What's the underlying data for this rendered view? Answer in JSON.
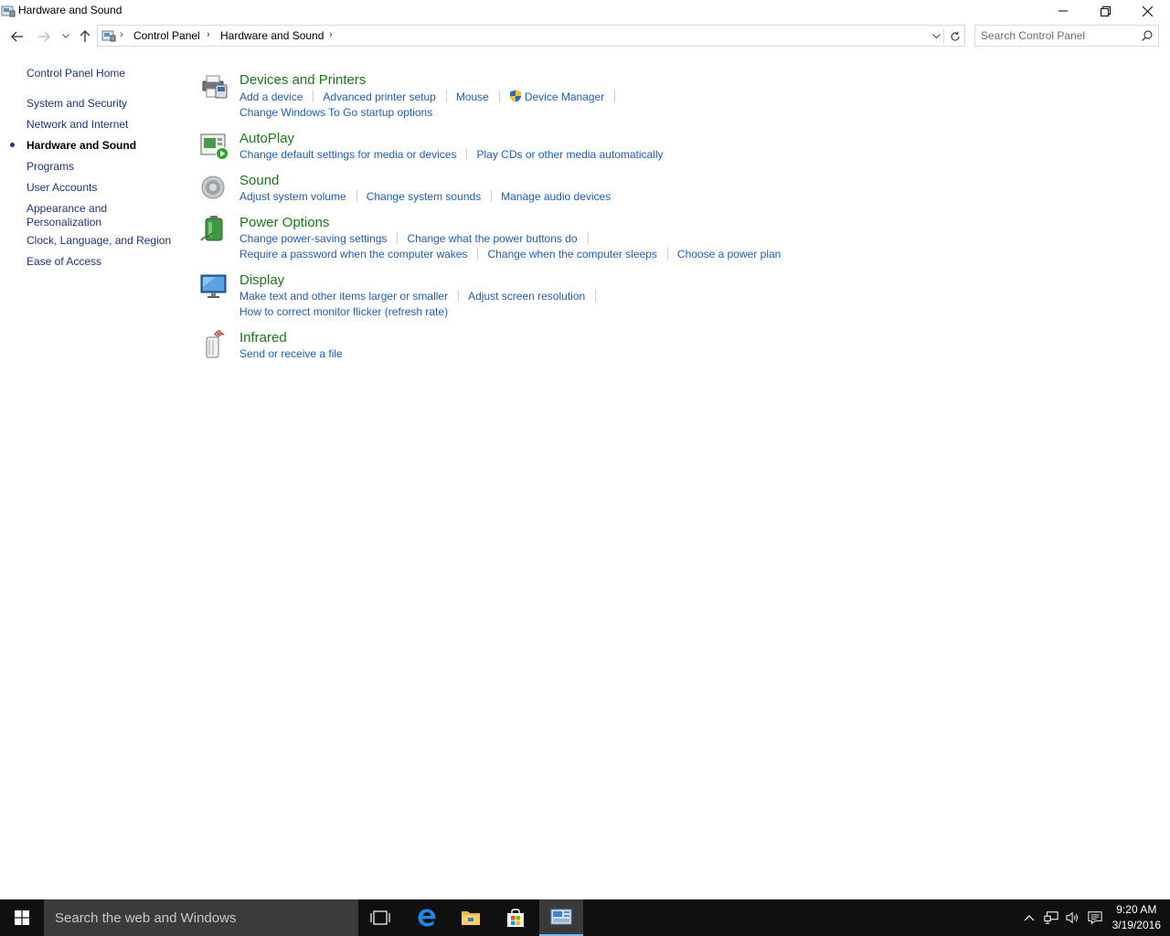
{
  "window": {
    "title": "Hardware and Sound"
  },
  "address": {
    "crumbs": [
      "Control Panel",
      "Hardware and Sound"
    ]
  },
  "search": {
    "placeholder": "Search Control Panel"
  },
  "sidebar": {
    "home": "Control Panel Home",
    "items": [
      {
        "label": "System and Security",
        "current": false
      },
      {
        "label": "Network and Internet",
        "current": false
      },
      {
        "label": "Hardware and Sound",
        "current": true
      },
      {
        "label": "Programs",
        "current": false
      },
      {
        "label": "User Accounts",
        "current": false
      },
      {
        "label": "Appearance and",
        "label2": "Personalization",
        "current": false
      },
      {
        "label": "Clock, Language, and Region",
        "current": false
      },
      {
        "label": "Ease of Access",
        "current": false
      }
    ]
  },
  "categories": [
    {
      "title": "Devices and Printers",
      "icon": "printer-icon",
      "tasks": [
        "Add a device",
        "Advanced printer setup",
        "Mouse",
        "Device Manager",
        "Change Windows To Go startup options"
      ]
    },
    {
      "title": "AutoPlay",
      "icon": "autoplay-icon",
      "tasks": [
        "Change default settings for media or devices",
        "Play CDs or other media automatically"
      ]
    },
    {
      "title": "Sound",
      "icon": "speaker-icon",
      "tasks": [
        "Adjust system volume",
        "Change system sounds",
        "Manage audio devices"
      ]
    },
    {
      "title": "Power Options",
      "icon": "battery-icon",
      "tasks": [
        "Change power-saving settings",
        "Change what the power buttons do",
        "Require a password when the computer wakes",
        "Change when the computer sleeps",
        "Choose a power plan"
      ]
    },
    {
      "title": "Display",
      "icon": "monitor-icon",
      "tasks": [
        "Make text and other items larger or smaller",
        "Adjust screen resolution",
        "How to correct monitor flicker (refresh rate)"
      ]
    },
    {
      "title": "Infrared",
      "icon": "infrared-icon",
      "tasks": [
        "Send or receive a file"
      ]
    }
  ],
  "taskbar": {
    "search_placeholder": "Search the web and Windows",
    "time": "9:20 AM",
    "date": "3/19/2016"
  },
  "colors": {
    "link": "#1e5ebe",
    "heading": "#1a7a1a",
    "nav_link": "#1e3287",
    "taskbar": "#101010"
  }
}
